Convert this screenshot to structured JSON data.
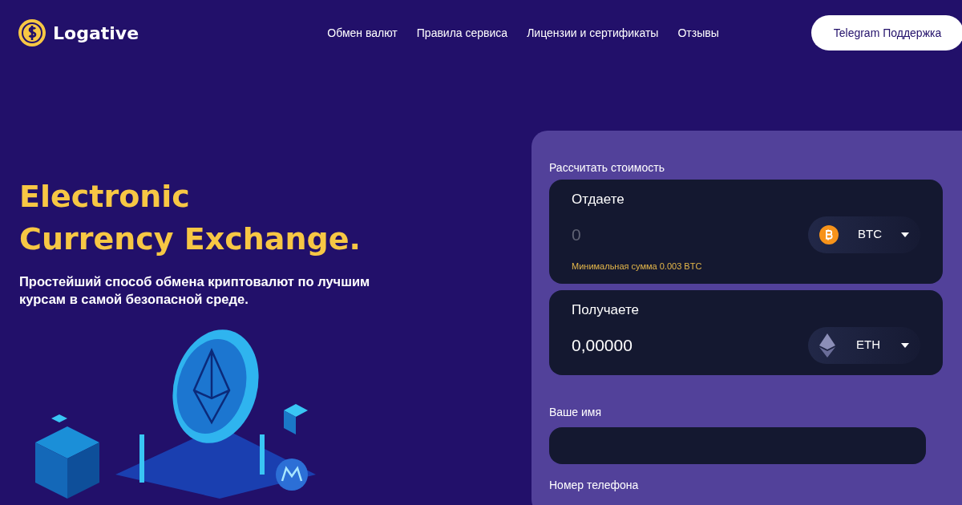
{
  "header": {
    "logo_text": "Logative",
    "nav": [
      {
        "label": "Обмен валют"
      },
      {
        "label": "Правила сервиса"
      },
      {
        "label": "Лицензии и сертификаты"
      },
      {
        "label": "Отзывы"
      }
    ],
    "support_button": "Telegram Поддержка"
  },
  "hero": {
    "title_lines": [
      "Electronic",
      "Currency Exchange."
    ],
    "subtitle": "Простейший способ обмена криптовалют по лучшим курсам в самой безопасной среде."
  },
  "calculator": {
    "title": "Рассчитать стоимость",
    "panels": [
      {
        "label": "Отдаете",
        "placeholder": "0",
        "currency": "BTC",
        "kind": "bitcoin",
        "note": "Минимальная сумма 0.003 BTC"
      },
      {
        "label": "Получаете",
        "value": "0,00000",
        "currency": "ETH",
        "kind": "ethereum"
      }
    ],
    "fields": [
      {
        "label": "Ваше имя"
      },
      {
        "label": "Номер телефона"
      }
    ]
  }
}
